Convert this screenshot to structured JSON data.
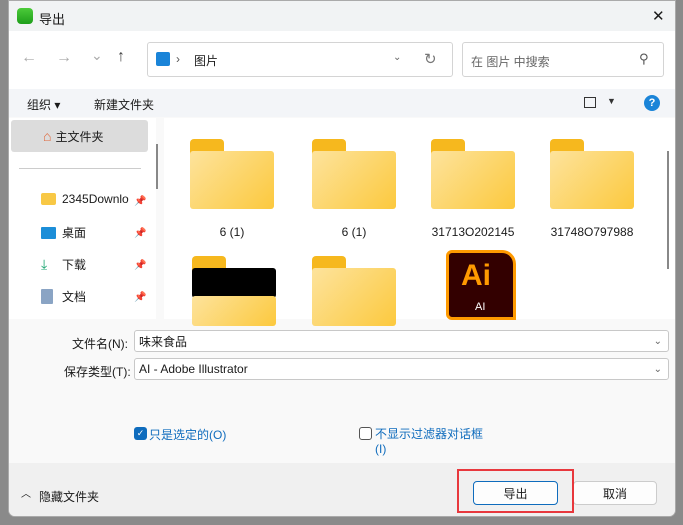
{
  "window": {
    "title": "导出",
    "close": "✕"
  },
  "nav": {
    "back": "←",
    "forward": "→",
    "recent": "⌄",
    "up": "↑",
    "breadcrumb": "图片",
    "search_placeholder": "在 图片 中搜索"
  },
  "toolbar": {
    "organize": "组织 ▾",
    "new_folder": "新建文件夹"
  },
  "sidebar": {
    "home": "主文件夹",
    "items": [
      {
        "label": "2345Downlo"
      },
      {
        "label": "桌面"
      },
      {
        "label": "下载"
      },
      {
        "label": "文档"
      }
    ]
  },
  "files": [
    {
      "name": "6 (1)"
    },
    {
      "name": "6 (1)"
    },
    {
      "name": "31713O202145"
    },
    {
      "name": "31748O797988"
    }
  ],
  "ai_icon": {
    "text": "Ai",
    "sub": "AI"
  },
  "form": {
    "filename_label": "文件名(N):",
    "filename_value": "味来食品",
    "type_label": "保存类型(T):",
    "type_value": "AI - Adobe Illustrator"
  },
  "options": {
    "selected_only": "只是选定的(O)",
    "selected_only_checked": true,
    "no_filter_dialog": "不显示过滤器对话框",
    "no_filter_dialog_key": "(I)",
    "no_filter_checked": false
  },
  "footer": {
    "hide_folders": "隐藏文件夹",
    "export": "导出",
    "cancel": "取消"
  },
  "colors": {
    "accent": "#0f6cbd",
    "highlight": "#e8383d"
  }
}
